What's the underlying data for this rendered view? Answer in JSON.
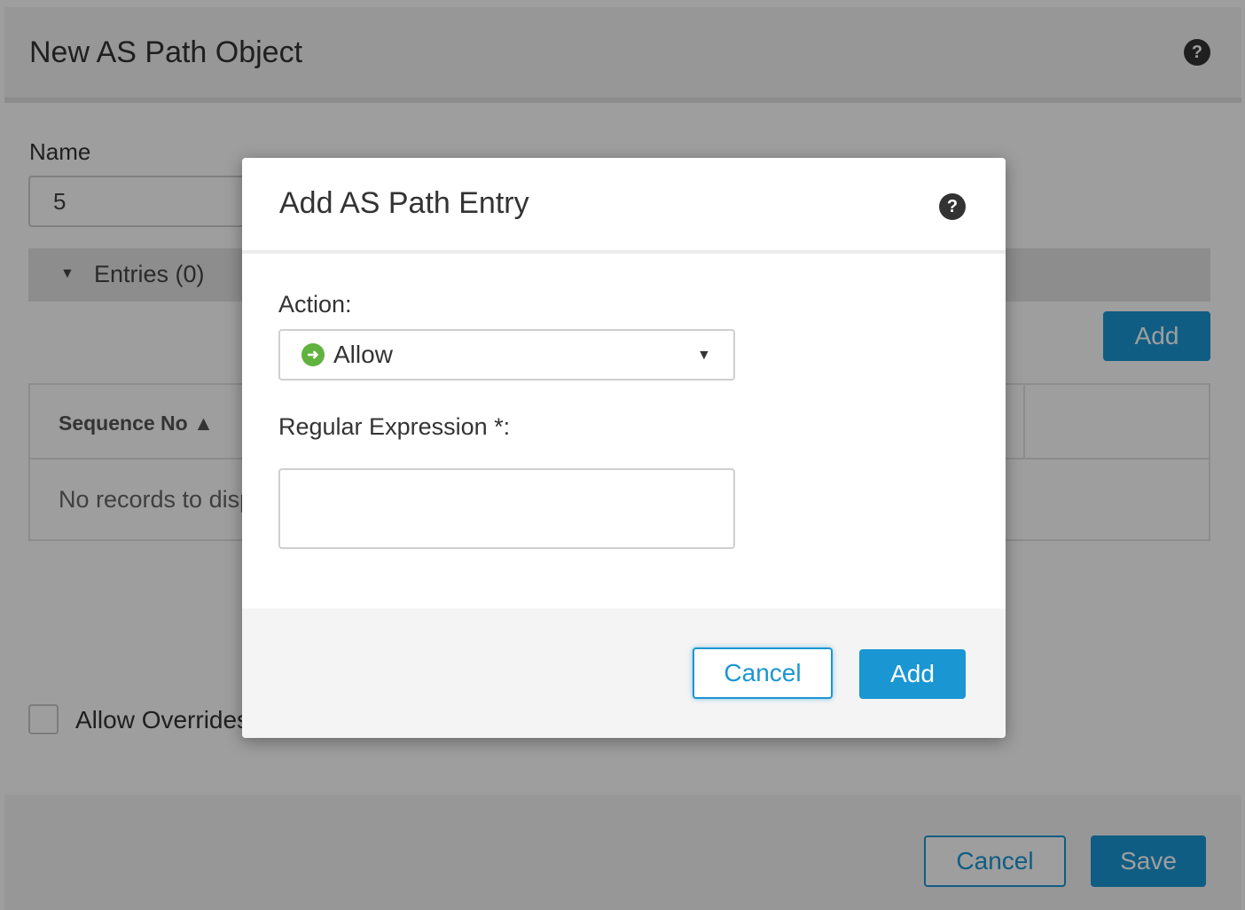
{
  "outer_dialog": {
    "title": "New AS Path Object",
    "help_icon": "?",
    "name_label": "Name",
    "name_value": "5",
    "entries_caret": "▼",
    "entries_label": "Entries (0)",
    "add_label": "Add",
    "table": {
      "columns": [
        "Sequence No ▲"
      ],
      "empty_text": "No records to display"
    },
    "allow_override_label": "Allow Overrides",
    "cancel_label": "Cancel",
    "save_label": "Save"
  },
  "modal": {
    "title": "Add AS Path Entry",
    "help_icon": "?",
    "action_label": "Action:",
    "action_icon": "➜",
    "action_value": "Allow",
    "select_caret": "▼",
    "regex_label": "Regular Expression *:",
    "regex_value": "",
    "cancel_label": "Cancel",
    "add_label": "Add"
  },
  "colors": {
    "primary": "#1a96d3",
    "allow_green": "#61b23f",
    "overlay": "rgba(0,0,0,0.38)"
  },
  "icons": {
    "help": "help-circle-icon",
    "allow": "arrow-right-circle-icon",
    "caret": "caret-down-icon"
  }
}
